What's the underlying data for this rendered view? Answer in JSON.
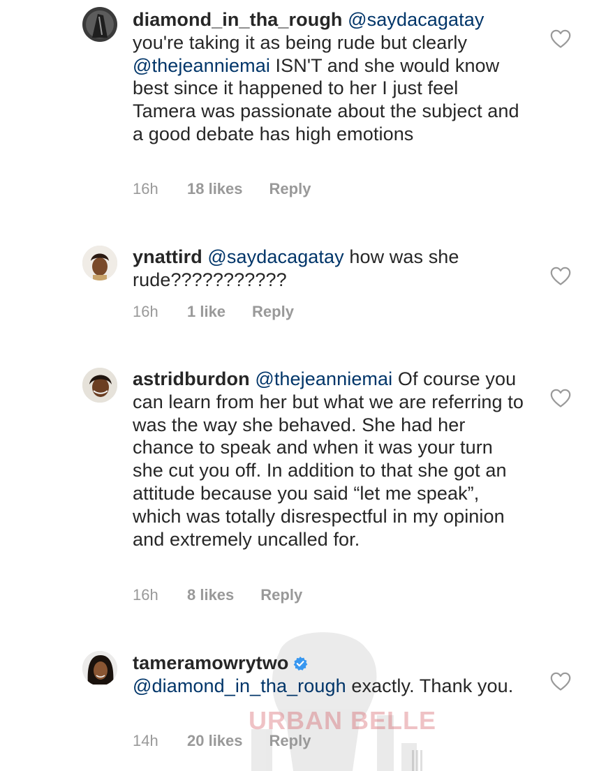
{
  "comments": [
    {
      "username": "diamond_in_tha_rough",
      "mention": "@saydacagatay",
      "text": " you're taking it as being rude but  clearly ",
      "mention2": "@thejeanniemai",
      "text2": " ISN'T and she would know best since it happened to her I just feel Tamera was passionate about the subject and a good debate has high emotions",
      "time": "16h",
      "likes": "18 likes",
      "reply": "Reply",
      "avatar_icon": "dark-portrait-avatar"
    },
    {
      "username": "ynattird",
      "mention": "@saydacagatay",
      "text": " how was she rude???????????",
      "time": "16h",
      "likes": "1 like",
      "reply": "Reply",
      "avatar_icon": "portrait-avatar"
    },
    {
      "username": "astridburdon",
      "mention": "@thejeanniemai",
      "text": " Of course you can learn from her but what we are referring to was the way she behaved. She had her chance to speak and when it was your turn she cut you off. In addition to that she got an attitude because you said “let me speak”, which was totally disrespectful in my opinion and extremely uncalled for.",
      "time": "16h",
      "likes": "8 likes",
      "reply": "Reply",
      "avatar_icon": "portrait-avatar"
    },
    {
      "username": "tameramowrytwo",
      "verified": true,
      "mention": "@diamond_in_tha_rough",
      "text": " exactly. Thank you.",
      "time": "14h",
      "likes": "20 likes",
      "reply": "Reply",
      "avatar_icon": "portrait-avatar"
    }
  ],
  "watermark": "URBAN BELLE",
  "colors": {
    "text": "#262626",
    "mention": "#003569",
    "meta": "#999999",
    "heart": "#999999",
    "verified": "#3897f0"
  },
  "icons": {
    "like": "heart-outline-icon",
    "verified": "verified-badge-icon"
  }
}
